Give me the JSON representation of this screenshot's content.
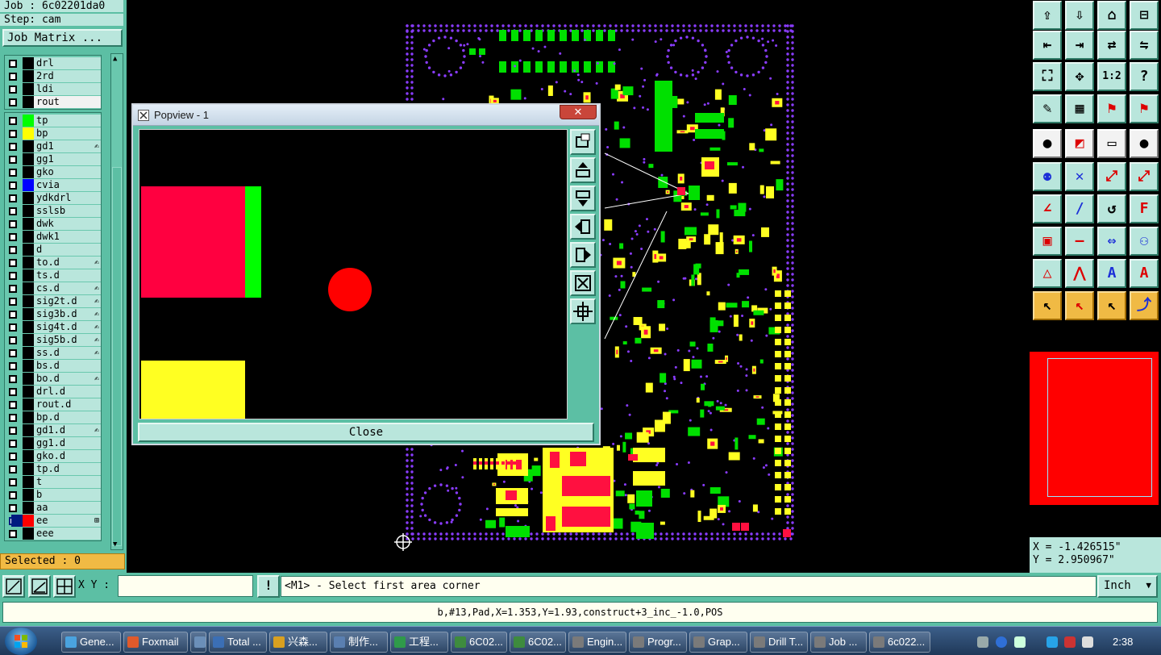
{
  "app": {
    "job_label": "Job : 6c02201da0",
    "step_label": "Step: cam",
    "job_matrix_label": "Job Matrix ...",
    "selected_label": "Selected : 0"
  },
  "layers_top": [
    {
      "name": "drl",
      "color": "#000000",
      "mark": ""
    },
    {
      "name": "2rd",
      "color": "#000000",
      "mark": ""
    },
    {
      "name": "ldi",
      "color": "#000000",
      "mark": ""
    },
    {
      "name": "rout",
      "color": "#000000",
      "mark": ""
    }
  ],
  "layers": [
    {
      "name": "tp",
      "color": "#00ff00",
      "mark": ""
    },
    {
      "name": "bp",
      "color": "#ffff00",
      "mark": ""
    },
    {
      "name": "gd1",
      "color": "#000000",
      "mark": "✍"
    },
    {
      "name": "gg1",
      "color": "#000000",
      "mark": ""
    },
    {
      "name": "gko",
      "color": "#000000",
      "mark": ""
    },
    {
      "name": "cvia",
      "color": "#0000ff",
      "mark": ""
    },
    {
      "name": "ydkdrl",
      "color": "#000000",
      "mark": ""
    },
    {
      "name": "sslsb",
      "color": "#000000",
      "mark": ""
    },
    {
      "name": "dwk",
      "color": "#000000",
      "mark": ""
    },
    {
      "name": "dwk1",
      "color": "#000000",
      "mark": ""
    },
    {
      "name": "d",
      "color": "#000000",
      "mark": ""
    },
    {
      "name": "to.d",
      "color": "#000000",
      "mark": "✍"
    },
    {
      "name": "ts.d",
      "color": "#000000",
      "mark": ""
    },
    {
      "name": "cs.d",
      "color": "#000000",
      "mark": "✍"
    },
    {
      "name": "sig2t.d",
      "color": "#000000",
      "mark": "✍"
    },
    {
      "name": "sig3b.d",
      "color": "#000000",
      "mark": "✍"
    },
    {
      "name": "sig4t.d",
      "color": "#000000",
      "mark": "✍"
    },
    {
      "name": "sig5b.d",
      "color": "#000000",
      "mark": "✍"
    },
    {
      "name": "ss.d",
      "color": "#000000",
      "mark": "✍"
    },
    {
      "name": "bs.d",
      "color": "#000000",
      "mark": ""
    },
    {
      "name": "bo.d",
      "color": "#000000",
      "mark": "✍"
    },
    {
      "name": "drl.d",
      "color": "#000000",
      "mark": ""
    },
    {
      "name": "rout.d",
      "color": "#000000",
      "mark": ""
    },
    {
      "name": "bp.d",
      "color": "#000000",
      "mark": ""
    },
    {
      "name": "gd1.d",
      "color": "#000000",
      "mark": "✍"
    },
    {
      "name": "gg1.d",
      "color": "#000000",
      "mark": ""
    },
    {
      "name": "gko.d",
      "color": "#000000",
      "mark": ""
    },
    {
      "name": "tp.d",
      "color": "#000000",
      "mark": ""
    },
    {
      "name": "t",
      "color": "#000000",
      "mark": ""
    },
    {
      "name": "b",
      "color": "#000000",
      "mark": ""
    },
    {
      "name": "aa",
      "color": "#000000",
      "mark": ""
    },
    {
      "name": "ee",
      "color": "#ff0000",
      "mark": "⊞"
    },
    {
      "name": "eee",
      "color": "#000000",
      "mark": ""
    }
  ],
  "popview": {
    "title": "Popview - 1",
    "close_x": "✕",
    "close_label": "Close"
  },
  "cmd": {
    "xy_label": "X Y :",
    "xy_value": "",
    "prompt": "<M1> - Select first area corner",
    "unit": "Inch"
  },
  "readout": {
    "x": "X = -1.426515\"",
    "y": "Y = 2.950967\""
  },
  "info": "b,#13,Pad,X=1.353,Y=1.93,construct+3_inc_-1.0,POS",
  "taskbar": {
    "items": [
      {
        "label": "Gene...",
        "color": "#4aa3df"
      },
      {
        "label": "Foxmail",
        "color": "#e05a2b"
      },
      {
        "label": "",
        "color": "#6b8fb8"
      },
      {
        "label": "Total ...",
        "color": "#3b6fb5"
      },
      {
        "label": "兴森...",
        "color": "#d9a020"
      },
      {
        "label": "制作...",
        "color": "#5a7fb0"
      },
      {
        "label": "工程...",
        "color": "#2f9a4a"
      },
      {
        "label": "6C02...",
        "color": "#3e8b3e"
      },
      {
        "label": "6C02...",
        "color": "#3e8b3e"
      },
      {
        "label": "Engin...",
        "color": "#7a7a7a"
      },
      {
        "label": "Progr...",
        "color": "#7a7a7a"
      },
      {
        "label": "Grap...",
        "color": "#7a7a7a"
      },
      {
        "label": "Drill T...",
        "color": "#7a7a7a"
      },
      {
        "label": "Job ...",
        "color": "#7a7a7a"
      },
      {
        "label": "6c022...",
        "color": "#7a7a7a"
      }
    ],
    "time": "2:38"
  }
}
